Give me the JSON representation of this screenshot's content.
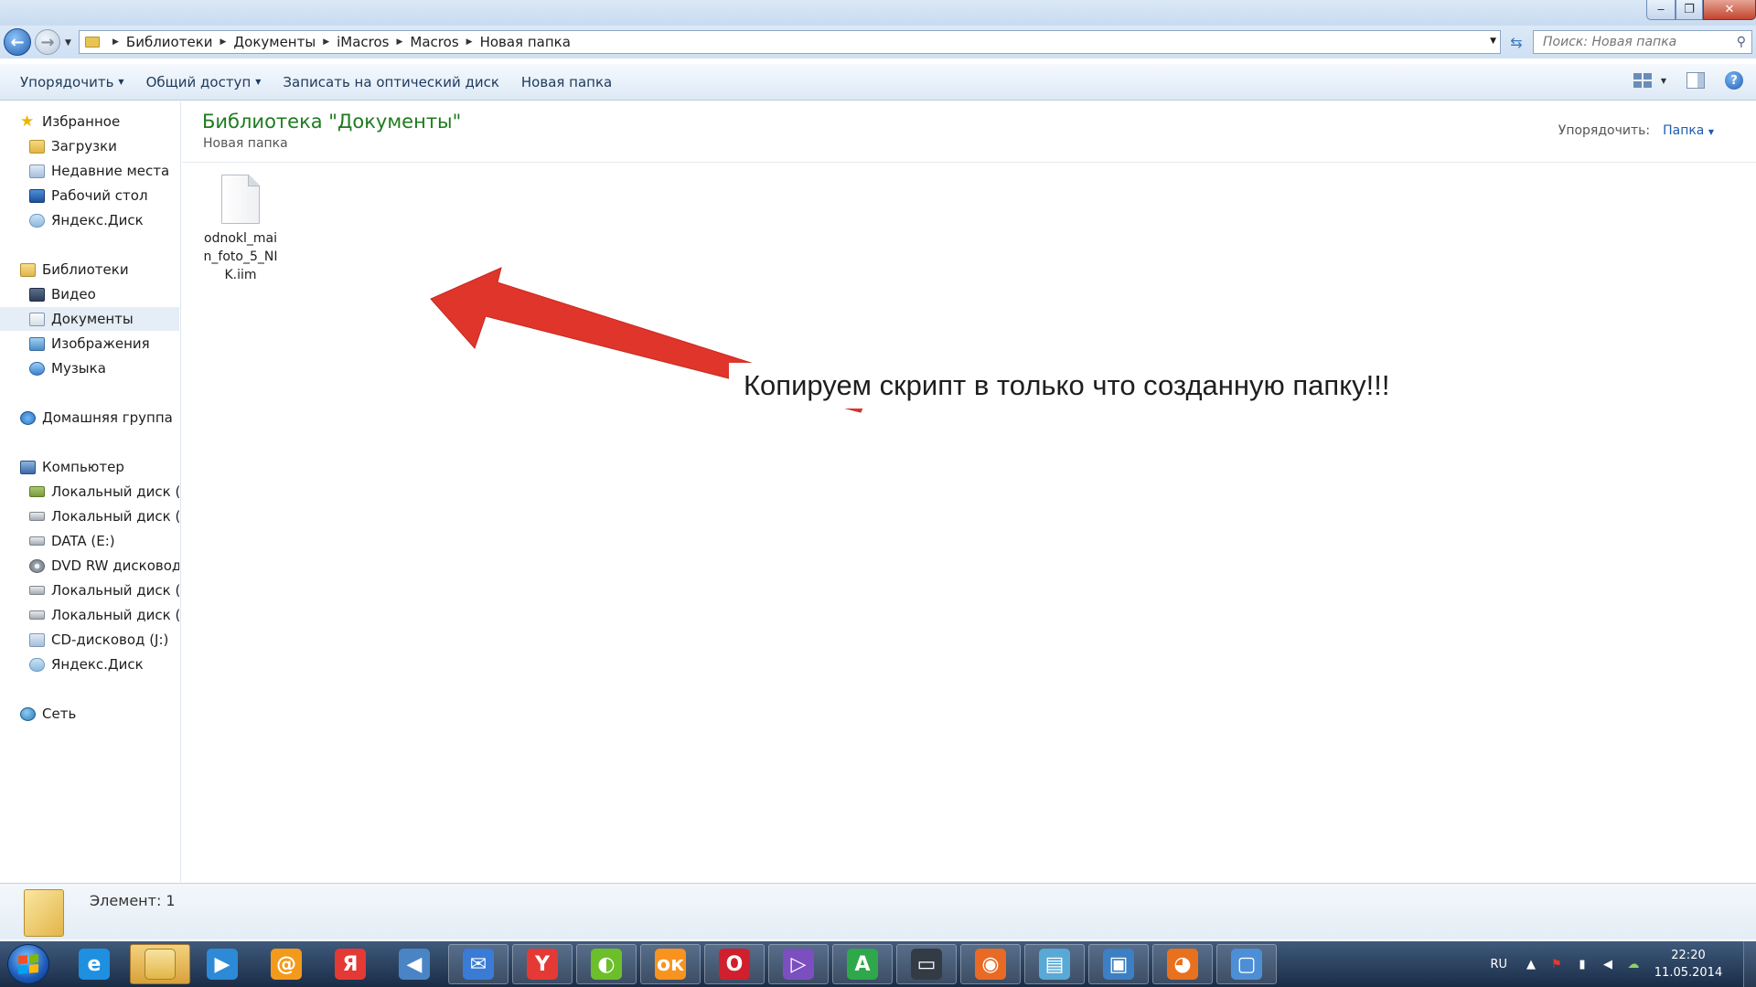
{
  "address": {
    "crumbs": [
      "Библиотеки",
      "Документы",
      "iMacros",
      "Macros",
      "Новая папка"
    ],
    "search_placeholder": "Поиск: Новая папка"
  },
  "window_controls": {
    "minimize": "‒",
    "maximize": "❐",
    "close": "✕"
  },
  "toolbar": {
    "organize": "Упорядочить",
    "share": "Общий доступ",
    "burn": "Записать на оптический диск",
    "new_folder": "Новая папка",
    "help": "?"
  },
  "nav": {
    "favorites": "Избранное",
    "downloads": "Загрузки",
    "recent": "Недавние места",
    "desktop": "Рабочий стол",
    "yadisk1": "Яндекс.Диск",
    "libraries": "Библиотеки",
    "video": "Видео",
    "documents": "Документы",
    "images": "Изображения",
    "music": "Музыка",
    "homegroup": "Домашняя группа",
    "computer": "Компьютер",
    "disk_c": "Локальный диск (C:",
    "disk_d": "Локальный диск (D:",
    "data_e": "DATA (E:)",
    "dvd": "DVD RW дисковод (",
    "disk_h": "Локальный диск (H:",
    "disk_i": "Локальный диск (I:)",
    "cd_j": "CD-дисковод (J:)",
    "yadisk2": "Яндекс.Диск",
    "network": "Сеть"
  },
  "content": {
    "title": "Библиотека \"Документы\"",
    "subtitle": "Новая папка",
    "arrange_label": "Упорядочить:",
    "arrange_value": "Папка",
    "file_name": "odnokl_main_foto_5_NIK.iim",
    "annotation": "Копируем скрипт в только что созданную папку!!!"
  },
  "details": {
    "count": "Элемент: 1"
  },
  "taskbar": {
    "apps": [
      {
        "name": "ie",
        "color": "#1f8fe0",
        "glyph": "e"
      },
      {
        "name": "explorer",
        "color": "#e6b84a",
        "glyph": ""
      },
      {
        "name": "media",
        "color": "#2d8ad6",
        "glyph": "▶"
      },
      {
        "name": "mail-ru",
        "color": "#f39a1b",
        "glyph": "@"
      },
      {
        "name": "yandex",
        "color": "#e53935",
        "glyph": "Я"
      },
      {
        "name": "volume",
        "color": "#4a84c4",
        "glyph": "◀"
      },
      {
        "name": "mail",
        "color": "#3a7bd5",
        "glyph": "✉"
      },
      {
        "name": "yandex-browser",
        "color": "#e53935",
        "glyph": "Y"
      },
      {
        "name": "apple-app",
        "color": "#6cbf2a",
        "glyph": "◐"
      },
      {
        "name": "odnoklassniki",
        "color": "#f7931e",
        "glyph": "ок"
      },
      {
        "name": "opera",
        "color": "#d0202d",
        "glyph": "O"
      },
      {
        "name": "visual-studio",
        "color": "#7b4fbf",
        "glyph": "▷"
      },
      {
        "name": "a-app",
        "color": "#2ea84a",
        "glyph": "A"
      },
      {
        "name": "terminal",
        "color": "#333b44",
        "glyph": "▭"
      },
      {
        "name": "orange-app",
        "color": "#e86a24",
        "glyph": "◉"
      },
      {
        "name": "notes",
        "color": "#58a9d6",
        "glyph": "▤"
      },
      {
        "name": "photos",
        "color": "#3c7fc2",
        "glyph": "▣"
      },
      {
        "name": "firefox",
        "color": "#e8711d",
        "glyph": "◕"
      },
      {
        "name": "monitor",
        "color": "#4d8fd6",
        "glyph": "▢"
      }
    ],
    "lang": "RU",
    "time": "22:20",
    "date": "11.05.2014"
  },
  "colors": {
    "title_green": "#1e7b1e",
    "link_blue": "#1e5bb3",
    "arrow_red": "#e0352b"
  }
}
